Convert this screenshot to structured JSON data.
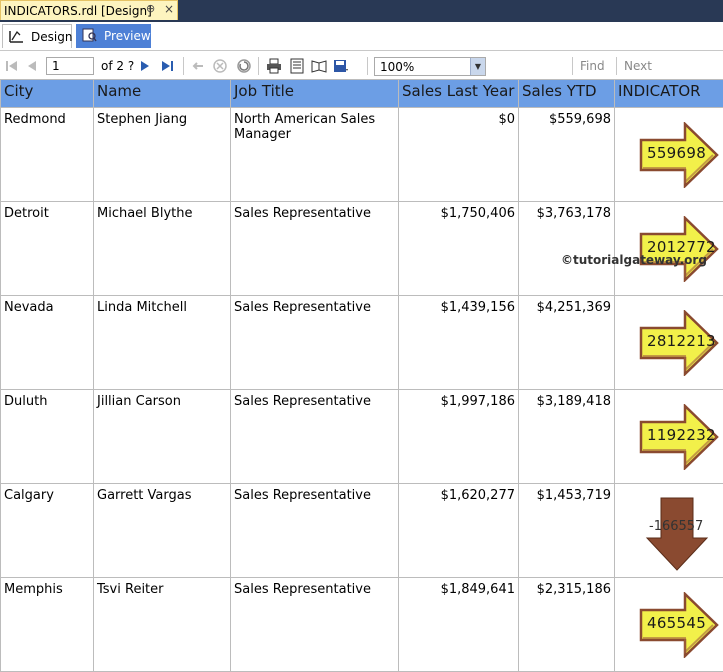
{
  "document_tab": {
    "title": "INDICATORS.rdl [Design]",
    "pin_glyph": "⊕",
    "close_glyph": "×"
  },
  "view_tabs": {
    "design": "Design",
    "preview": "Preview"
  },
  "toolbar": {
    "page": "1",
    "of": "of 2 ?",
    "zoom": "100%",
    "find": "Find",
    "next": "Next"
  },
  "table": {
    "headers": [
      "City",
      "Name",
      "Job Title",
      "Sales Last Year",
      "Sales YTD",
      "INDICATOR"
    ],
    "rows": [
      {
        "city": "Redmond",
        "name": "Stephen Jiang",
        "job": "North American Sales Manager",
        "last": "$0",
        "ytd": "$559,698",
        "indicator": "559698",
        "direction": "up"
      },
      {
        "city": "Detroit",
        "name": "Michael Blythe",
        "job": "Sales Representative",
        "last": "$1,750,406",
        "ytd": "$3,763,178",
        "indicator": "2012772",
        "direction": "up"
      },
      {
        "city": "Nevada",
        "name": "Linda Mitchell",
        "job": "Sales Representative",
        "last": "$1,439,156",
        "ytd": "$4,251,369",
        "indicator": "2812213",
        "direction": "up"
      },
      {
        "city": "Duluth",
        "name": "Jillian Carson",
        "job": "Sales Representative",
        "last": "$1,997,186",
        "ytd": "$3,189,418",
        "indicator": "1192232",
        "direction": "up"
      },
      {
        "city": "Calgary",
        "name": "Garrett Vargas",
        "job": "Sales Representative",
        "last": "$1,620,277",
        "ytd": "$1,453,719",
        "indicator": "-166557",
        "direction": "down"
      },
      {
        "city": "Memphis",
        "name": "Tsvi Reiter",
        "job": "Sales Representative",
        "last": "$1,849,641",
        "ytd": "$2,315,186",
        "indicator": "465545",
        "direction": "up"
      }
    ]
  },
  "watermark": "©tutorialgateway.org",
  "colors": {
    "header_bg": "#6c9ee5",
    "up_arrow": "#f2f04a",
    "down_arrow": "#8a4a30",
    "tab_bar": "#293955"
  },
  "icons": [
    "first-page-icon",
    "prev-page-icon",
    "next-page-icon",
    "last-page-icon",
    "back-icon",
    "stop-icon",
    "refresh-icon",
    "print-icon",
    "print-layout-icon",
    "page-setup-icon",
    "export-icon"
  ]
}
